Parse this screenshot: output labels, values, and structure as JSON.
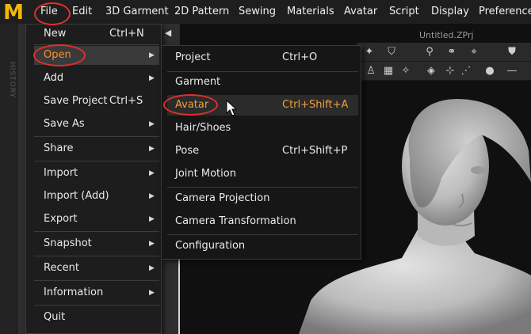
{
  "app": {
    "logo_letter": "M",
    "history_label": "HISTORY",
    "viewport_title": "Untitled.ZPrj",
    "collapse_arrow": "◀"
  },
  "menubar": {
    "items": [
      "File",
      "Edit",
      "3D Garment",
      "2D Pattern",
      "Sewing",
      "Materials",
      "Avatar",
      "Script",
      "Display",
      "Preferences"
    ]
  },
  "file_menu": {
    "items": [
      {
        "label": "New",
        "shortcut": "Ctrl+N",
        "submenu": false
      },
      {
        "label": "Open",
        "shortcut": "",
        "submenu": true,
        "active": true
      },
      {
        "label": "Add",
        "shortcut": "",
        "submenu": true
      },
      {
        "label": "Save Project",
        "shortcut": "Ctrl+S",
        "submenu": false
      },
      {
        "label": "Save As",
        "shortcut": "",
        "submenu": true
      },
      {
        "label": "Share",
        "shortcut": "",
        "submenu": true
      },
      {
        "label": "Import",
        "shortcut": "",
        "submenu": true
      },
      {
        "label": "Import (Add)",
        "shortcut": "",
        "submenu": true
      },
      {
        "label": "Export",
        "shortcut": "",
        "submenu": true
      },
      {
        "label": "Snapshot",
        "shortcut": "",
        "submenu": true
      },
      {
        "label": "Recent",
        "shortcut": "",
        "submenu": true
      },
      {
        "label": "Information",
        "shortcut": "",
        "submenu": true
      },
      {
        "label": "Quit",
        "shortcut": "",
        "submenu": false
      }
    ],
    "submenu_arrow": "▶"
  },
  "open_submenu": {
    "items": [
      {
        "label": "Project",
        "shortcut": "Ctrl+O"
      },
      {
        "label": "Garment",
        "shortcut": ""
      },
      {
        "label": "Avatar",
        "shortcut": "Ctrl+Shift+A",
        "active": true
      },
      {
        "label": "Hair/Shoes",
        "shortcut": ""
      },
      {
        "label": "Pose",
        "shortcut": "Ctrl+Shift+P"
      },
      {
        "label": "Joint Motion",
        "shortcut": ""
      },
      {
        "label": "Camera Projection",
        "shortcut": ""
      },
      {
        "label": "Camera Transformation",
        "shortcut": ""
      },
      {
        "label": "Configuration",
        "shortcut": ""
      }
    ]
  },
  "colors": {
    "accent_orange": "#ff8f2e",
    "annotation_red": "#e0302c",
    "logo_yellow": "#f2b705"
  },
  "toolbar_icons": [
    "garment-tool-icon",
    "shirt-icon",
    "fold-icon",
    "arrange-icon",
    "tack-icon",
    "shirt-pin-icon",
    "avatar-icon",
    "texture-icon",
    "pin-icon",
    "strap-icon",
    "bone-icon",
    "sewing-icon",
    "dot-icon",
    "line-icon"
  ]
}
